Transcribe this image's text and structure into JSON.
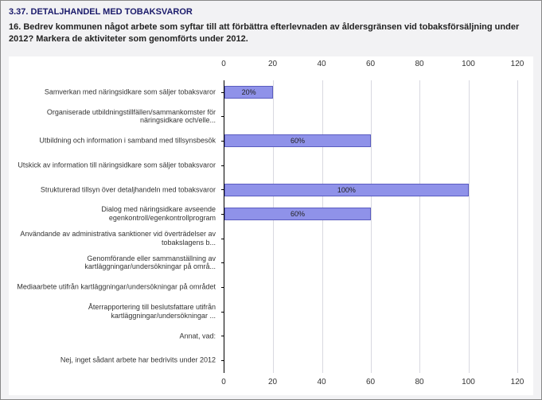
{
  "header": {
    "title": "3.37. DETALJHANDEL MED TOBAKSVAROR",
    "question": "16. Bedrev kommunen något arbete som syftar till att förbättra efterlevnaden av åldersgränsen vid tobaksförsäljning under 2012? Markera de aktiviteter som genomförts under 2012."
  },
  "chart_data": {
    "type": "bar",
    "orientation": "horizontal",
    "xlim": [
      0,
      120
    ],
    "ticks": [
      0,
      20,
      40,
      60,
      80,
      100,
      120
    ],
    "categories": [
      {
        "label": "Samverkan med näringsidkare som säljer tobaksvaror",
        "value": 20,
        "display": "20%"
      },
      {
        "label": "Organiserade utbildningstillfällen/sammankomster för näringsidkare och/elle...",
        "value": 0,
        "display": ""
      },
      {
        "label": "Utbildning och information i samband med tillsynsbesök",
        "value": 60,
        "display": "60%"
      },
      {
        "label": "Utskick av information till näringsidkare som säljer tobaksvaror",
        "value": 0,
        "display": ""
      },
      {
        "label": "Strukturerad tillsyn över detaljhandeln med tobaksvaror",
        "value": 100,
        "display": "100%"
      },
      {
        "label": "Dialog med näringsidkare avseende egenkontroll/egenkontrollprogram",
        "value": 60,
        "display": "60%"
      },
      {
        "label": "Användande av administrativa sanktioner vid överträdelser av tobakslagens b...",
        "value": 0,
        "display": ""
      },
      {
        "label": "Genomförande eller sammanställning av kartläggningar/undersökningar på områ...",
        "value": 0,
        "display": ""
      },
      {
        "label": "Mediaarbete utifrån kartläggningar/undersökningar på området",
        "value": 0,
        "display": ""
      },
      {
        "label": "Återrapportering till beslutsfattare utifrån kartläggningar/undersökningar ...",
        "value": 0,
        "display": ""
      },
      {
        "label": "Annat, vad:",
        "value": 0,
        "display": ""
      },
      {
        "label": "Nej, inget sådant arbete har bedrivits under 2012",
        "value": 0,
        "display": ""
      }
    ]
  }
}
